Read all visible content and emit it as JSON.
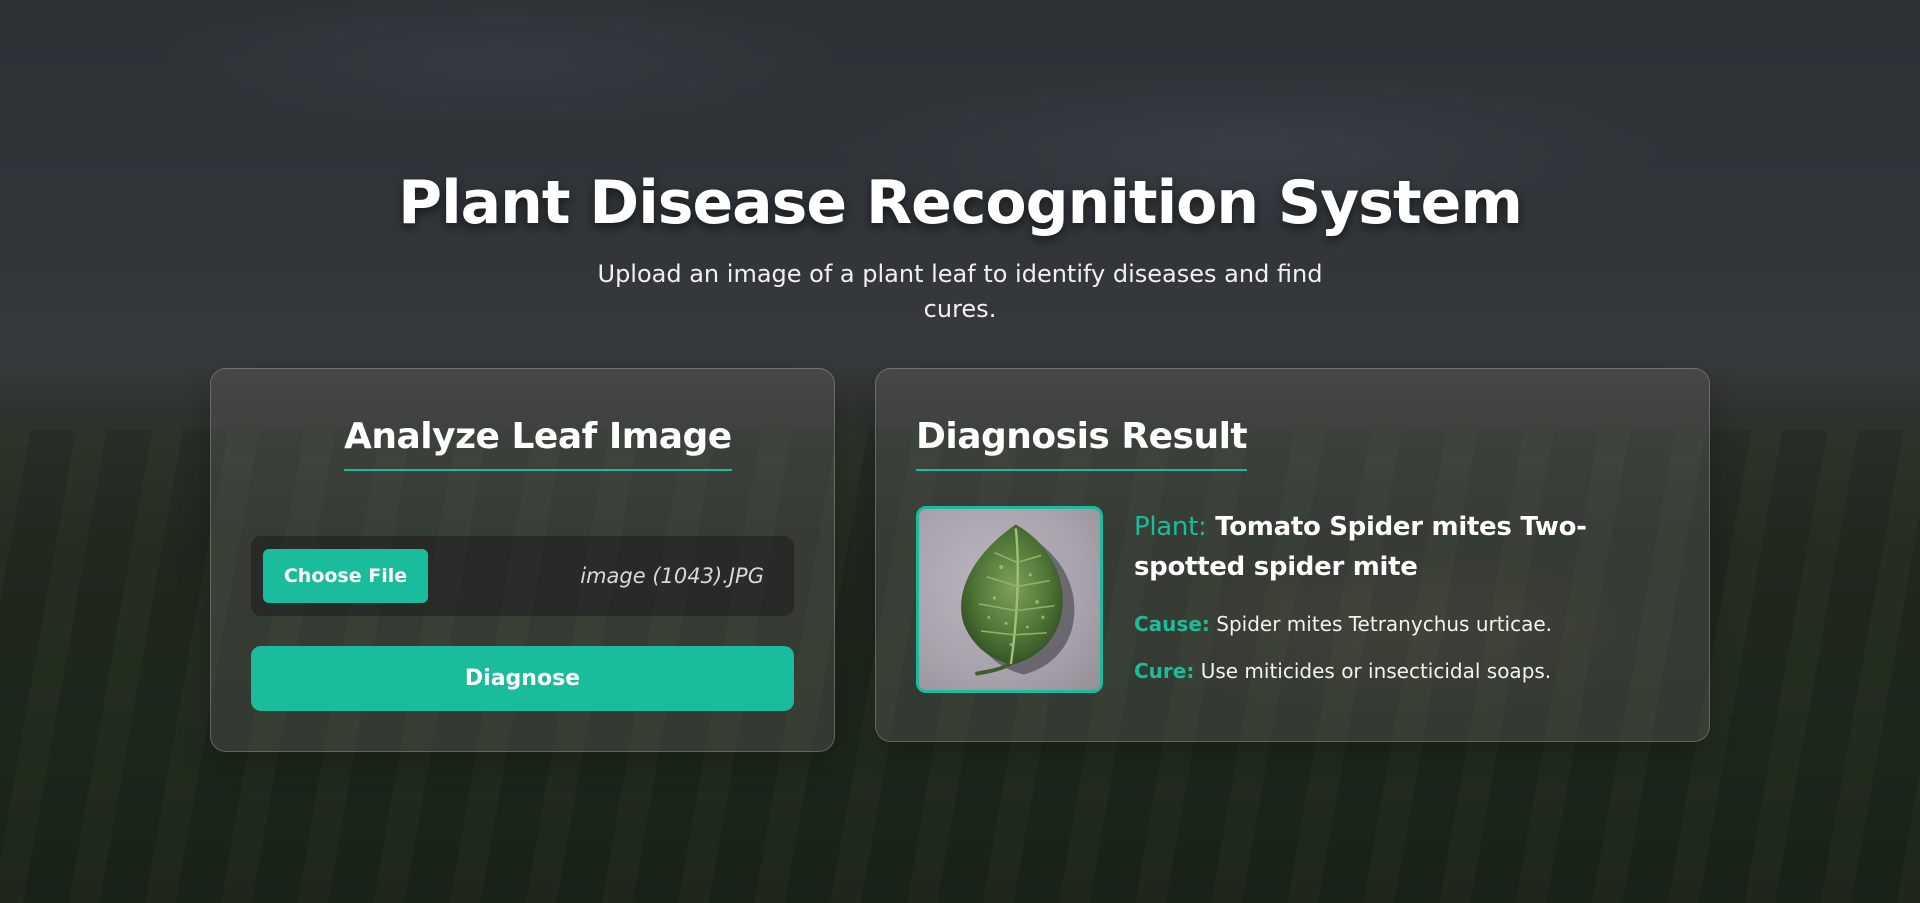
{
  "header": {
    "title": "Plant Disease Recognition System",
    "subtitle": "Upload an image of a plant leaf to identify diseases and find cures."
  },
  "analyze_card": {
    "heading": "Analyze Leaf Image",
    "choose_file_label": "Choose File",
    "file_name": "image (1043).JPG",
    "diagnose_label": "Diagnose"
  },
  "result_card": {
    "heading": "Diagnosis Result",
    "plant_label": "Plant:",
    "plant_value": "Tomato Spider mites Two-spotted spider mite",
    "cause_label": "Cause:",
    "cause_value": "Spider mites Tetranychus urticae.",
    "cure_label": "Cure:",
    "cure_value": "Use miticides or insecticidal soaps."
  },
  "colors": {
    "accent": "#1abc9c",
    "text": "#ffffff"
  },
  "icons": {
    "leaf_image": "leaf-photo"
  }
}
